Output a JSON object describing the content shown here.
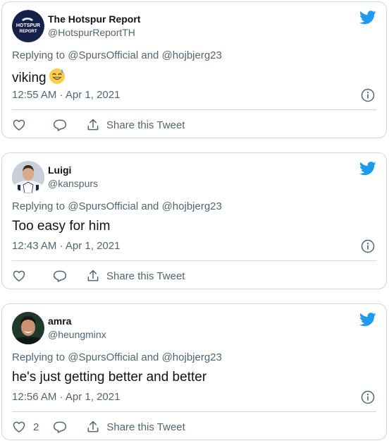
{
  "tweets": [
    {
      "name": "The Hotspur Report",
      "handle": "@HotspurReportTH",
      "reply_prefix": "Replying to",
      "reply_to_1": "@SpursOfficial",
      "reply_and": "and",
      "reply_to_2": "@hojbjerg23",
      "text": "viking",
      "emoji": "grinning-sweat-emoji",
      "time": "12:55 AM · Apr 1, 2021",
      "like_count": "",
      "share_label": "Share this Tweet"
    },
    {
      "name": "Luigi",
      "handle": "@kanspurs",
      "reply_prefix": "Replying to",
      "reply_to_1": "@SpursOfficial",
      "reply_and": "and",
      "reply_to_2": "@hojbjerg23",
      "text": "Too easy for him",
      "time": "12:43 AM · Apr 1, 2021",
      "like_count": "",
      "share_label": "Share this Tweet"
    },
    {
      "name": "amra",
      "handle": "@heungminx",
      "reply_prefix": "Replying to",
      "reply_to_1": "@SpursOfficial",
      "reply_and": "and",
      "reply_to_2": "@hojbjerg23",
      "text": "he's just getting better and better",
      "time": "12:56 AM · Apr 1, 2021",
      "like_count": "2",
      "share_label": "Share this Tweet"
    }
  ],
  "logo_text_line1": "HOTSPUR",
  "logo_text_line2": "REPORT",
  "colors": {
    "twitter_blue": "#1d9bf0",
    "text": "#0f1419",
    "secondary": "#536471",
    "border": "#cfd9de"
  }
}
